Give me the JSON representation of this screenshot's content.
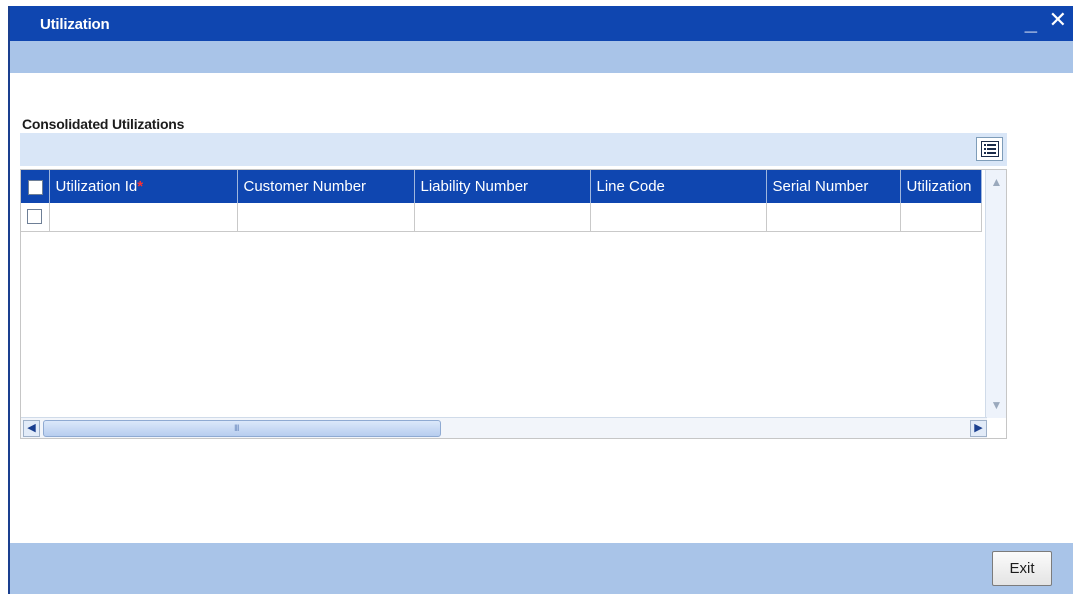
{
  "window": {
    "title": "Utilization",
    "minimize_label": "_",
    "close_label": "✕"
  },
  "section": {
    "title": "Consolidated Utilizations"
  },
  "grid": {
    "columns": [
      {
        "label": "Utilization Id",
        "required": true,
        "required_mark": "*"
      },
      {
        "label": "Customer Number"
      },
      {
        "label": "Liability Number"
      },
      {
        "label": "Line Code"
      },
      {
        "label": "Serial Number"
      },
      {
        "label": "Utilization"
      }
    ],
    "rows": [
      {
        "selected": false,
        "cells": [
          "",
          "",
          "",
          "",
          "",
          ""
        ]
      }
    ],
    "menu_icon": "list-icon",
    "scroll": {
      "left_icon": "arrow-left-icon",
      "right_icon": "arrow-right-icon",
      "up_icon": "arrow-up-icon",
      "down_icon": "arrow-down-icon",
      "grip": "III"
    }
  },
  "footer": {
    "exit_label": "Exit"
  },
  "colors": {
    "title_bar": "#0f46b0",
    "strip": "#a9c4e8",
    "grid_header": "#0f46b0",
    "grid_toolbar": "#d9e6f7",
    "required": "#ff3030"
  }
}
